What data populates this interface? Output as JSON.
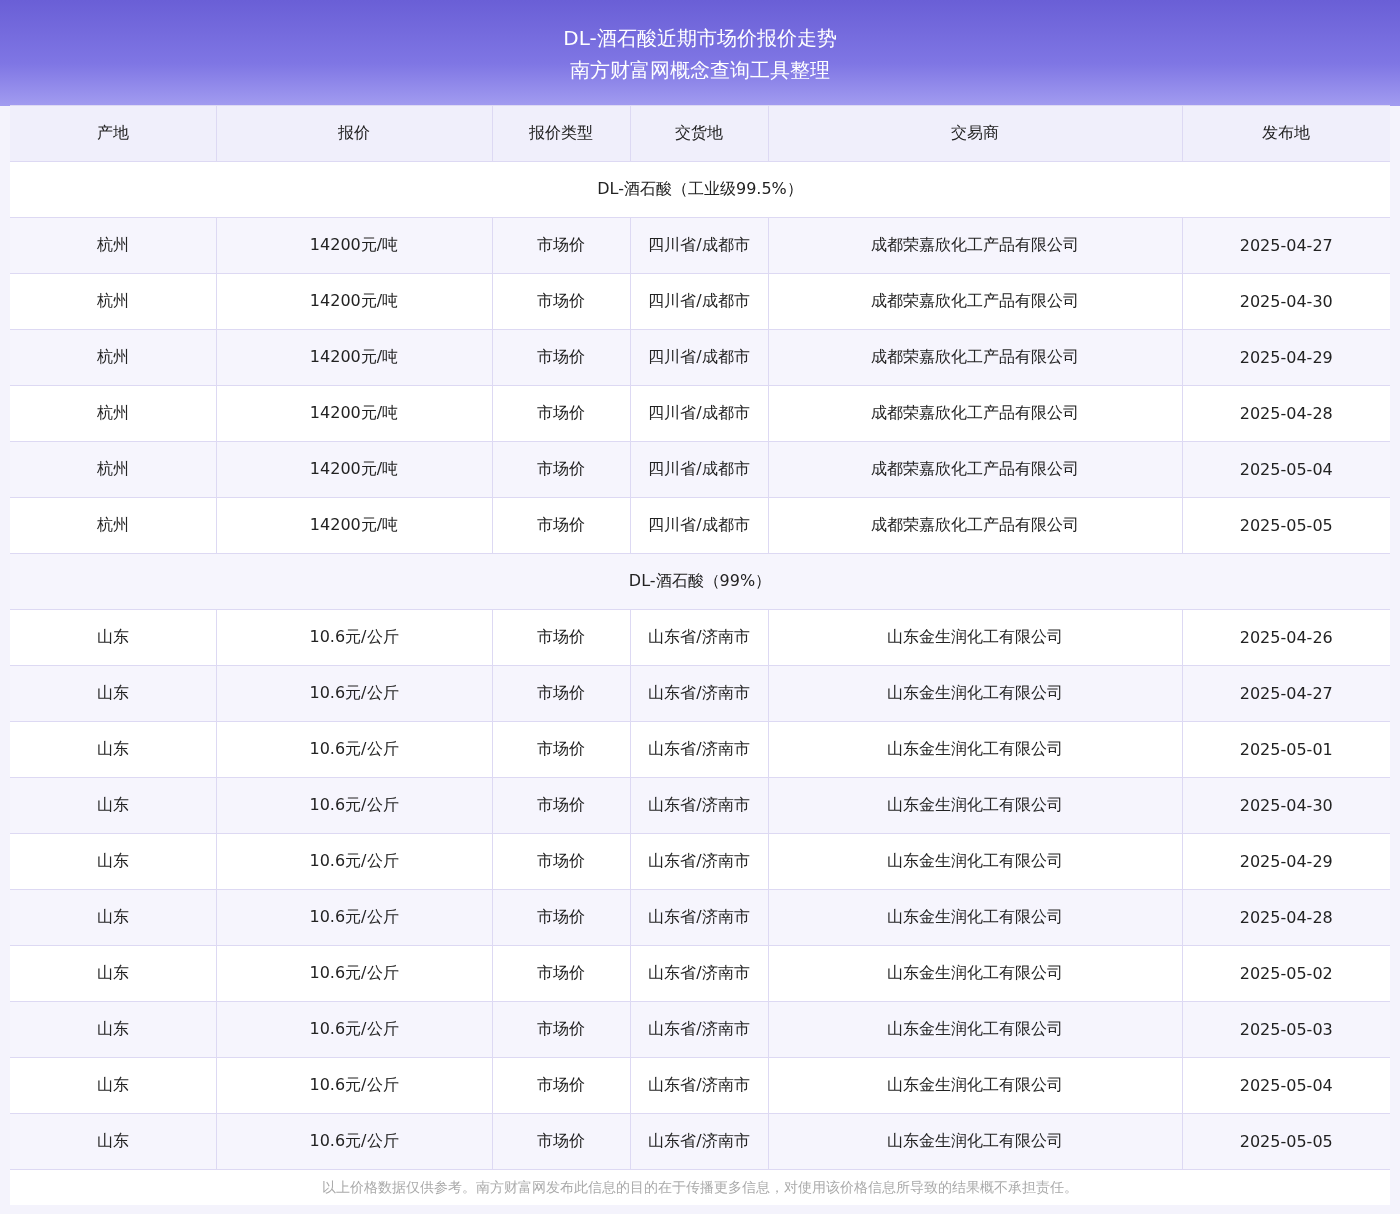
{
  "header": {
    "title": "DL-酒石酸近期市场价报价走势",
    "subtitle": "南方财富网概念查询工具整理"
  },
  "table": {
    "columns": [
      "产地",
      "报价",
      "报价类型",
      "交货地",
      "交易商",
      "发布地"
    ],
    "groups": [
      {
        "title": "DL-酒石酸（工业级99.5%）",
        "rows": [
          [
            "杭州",
            "14200元/吨",
            "市场价",
            "四川省/成都市",
            "成都荣嘉欣化工产品有限公司",
            "2025-04-27"
          ],
          [
            "杭州",
            "14200元/吨",
            "市场价",
            "四川省/成都市",
            "成都荣嘉欣化工产品有限公司",
            "2025-04-30"
          ],
          [
            "杭州",
            "14200元/吨",
            "市场价",
            "四川省/成都市",
            "成都荣嘉欣化工产品有限公司",
            "2025-04-29"
          ],
          [
            "杭州",
            "14200元/吨",
            "市场价",
            "四川省/成都市",
            "成都荣嘉欣化工产品有限公司",
            "2025-04-28"
          ],
          [
            "杭州",
            "14200元/吨",
            "市场价",
            "四川省/成都市",
            "成都荣嘉欣化工产品有限公司",
            "2025-05-04"
          ],
          [
            "杭州",
            "14200元/吨",
            "市场价",
            "四川省/成都市",
            "成都荣嘉欣化工产品有限公司",
            "2025-05-05"
          ]
        ]
      },
      {
        "title": "DL-酒石酸（99%）",
        "rows": [
          [
            "山东",
            "10.6元/公斤",
            "市场价",
            "山东省/济南市",
            "山东金生润化工有限公司",
            "2025-04-26"
          ],
          [
            "山东",
            "10.6元/公斤",
            "市场价",
            "山东省/济南市",
            "山东金生润化工有限公司",
            "2025-04-27"
          ],
          [
            "山东",
            "10.6元/公斤",
            "市场价",
            "山东省/济南市",
            "山东金生润化工有限公司",
            "2025-05-01"
          ],
          [
            "山东",
            "10.6元/公斤",
            "市场价",
            "山东省/济南市",
            "山东金生润化工有限公司",
            "2025-04-30"
          ],
          [
            "山东",
            "10.6元/公斤",
            "市场价",
            "山东省/济南市",
            "山东金生润化工有限公司",
            "2025-04-29"
          ],
          [
            "山东",
            "10.6元/公斤",
            "市场价",
            "山东省/济南市",
            "山东金生润化工有限公司",
            "2025-04-28"
          ],
          [
            "山东",
            "10.6元/公斤",
            "市场价",
            "山东省/济南市",
            "山东金生润化工有限公司",
            "2025-05-02"
          ],
          [
            "山东",
            "10.6元/公斤",
            "市场价",
            "山东省/济南市",
            "山东金生润化工有限公司",
            "2025-05-03"
          ],
          [
            "山东",
            "10.6元/公斤",
            "市场价",
            "山东省/济南市",
            "山东金生润化工有限公司",
            "2025-05-04"
          ],
          [
            "山东",
            "10.6元/公斤",
            "市场价",
            "山东省/济南市",
            "山东金生润化工有限公司",
            "2025-05-05"
          ]
        ]
      }
    ]
  },
  "footer": "以上价格数据仅供参考。南方财富网发布此信息的目的在于传播更多信息，对使用该价格信息所导致的结果概不承担责任。"
}
